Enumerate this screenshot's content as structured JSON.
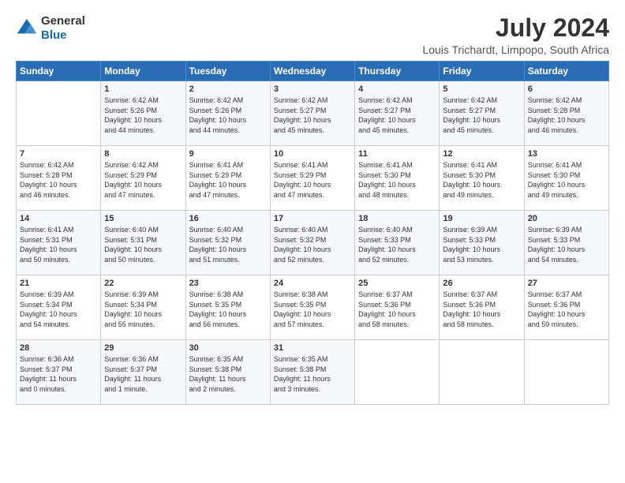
{
  "header": {
    "logo_line1": "General",
    "logo_line2": "Blue",
    "title": "July 2024",
    "subtitle": "Louis Trichardt, Limpopo, South Africa"
  },
  "calendar": {
    "days_of_week": [
      "Sunday",
      "Monday",
      "Tuesday",
      "Wednesday",
      "Thursday",
      "Friday",
      "Saturday"
    ],
    "weeks": [
      [
        {
          "day": "",
          "info": ""
        },
        {
          "day": "1",
          "info": "Sunrise: 6:42 AM\nSunset: 5:26 PM\nDaylight: 10 hours\nand 44 minutes."
        },
        {
          "day": "2",
          "info": "Sunrise: 6:42 AM\nSunset: 5:26 PM\nDaylight: 10 hours\nand 44 minutes."
        },
        {
          "day": "3",
          "info": "Sunrise: 6:42 AM\nSunset: 5:27 PM\nDaylight: 10 hours\nand 45 minutes."
        },
        {
          "day": "4",
          "info": "Sunrise: 6:42 AM\nSunset: 5:27 PM\nDaylight: 10 hours\nand 45 minutes."
        },
        {
          "day": "5",
          "info": "Sunrise: 6:42 AM\nSunset: 5:27 PM\nDaylight: 10 hours\nand 45 minutes."
        },
        {
          "day": "6",
          "info": "Sunrise: 6:42 AM\nSunset: 5:28 PM\nDaylight: 10 hours\nand 46 minutes."
        }
      ],
      [
        {
          "day": "7",
          "info": "Sunrise: 6:42 AM\nSunset: 5:28 PM\nDaylight: 10 hours\nand 46 minutes."
        },
        {
          "day": "8",
          "info": "Sunrise: 6:42 AM\nSunset: 5:29 PM\nDaylight: 10 hours\nand 47 minutes."
        },
        {
          "day": "9",
          "info": "Sunrise: 6:41 AM\nSunset: 5:29 PM\nDaylight: 10 hours\nand 47 minutes."
        },
        {
          "day": "10",
          "info": "Sunrise: 6:41 AM\nSunset: 5:29 PM\nDaylight: 10 hours\nand 47 minutes."
        },
        {
          "day": "11",
          "info": "Sunrise: 6:41 AM\nSunset: 5:30 PM\nDaylight: 10 hours\nand 48 minutes."
        },
        {
          "day": "12",
          "info": "Sunrise: 6:41 AM\nSunset: 5:30 PM\nDaylight: 10 hours\nand 49 minutes."
        },
        {
          "day": "13",
          "info": "Sunrise: 6:41 AM\nSunset: 5:30 PM\nDaylight: 10 hours\nand 49 minutes."
        }
      ],
      [
        {
          "day": "14",
          "info": "Sunrise: 6:41 AM\nSunset: 5:31 PM\nDaylight: 10 hours\nand 50 minutes."
        },
        {
          "day": "15",
          "info": "Sunrise: 6:40 AM\nSunset: 5:31 PM\nDaylight: 10 hours\nand 50 minutes."
        },
        {
          "day": "16",
          "info": "Sunrise: 6:40 AM\nSunset: 5:32 PM\nDaylight: 10 hours\nand 51 minutes."
        },
        {
          "day": "17",
          "info": "Sunrise: 6:40 AM\nSunset: 5:32 PM\nDaylight: 10 hours\nand 52 minutes."
        },
        {
          "day": "18",
          "info": "Sunrise: 6:40 AM\nSunset: 5:33 PM\nDaylight: 10 hours\nand 52 minutes."
        },
        {
          "day": "19",
          "info": "Sunrise: 6:39 AM\nSunset: 5:33 PM\nDaylight: 10 hours\nand 53 minutes."
        },
        {
          "day": "20",
          "info": "Sunrise: 6:39 AM\nSunset: 5:33 PM\nDaylight: 10 hours\nand 54 minutes."
        }
      ],
      [
        {
          "day": "21",
          "info": "Sunrise: 6:39 AM\nSunset: 5:34 PM\nDaylight: 10 hours\nand 54 minutes."
        },
        {
          "day": "22",
          "info": "Sunrise: 6:39 AM\nSunset: 5:34 PM\nDaylight: 10 hours\nand 55 minutes."
        },
        {
          "day": "23",
          "info": "Sunrise: 6:38 AM\nSunset: 5:35 PM\nDaylight: 10 hours\nand 56 minutes."
        },
        {
          "day": "24",
          "info": "Sunrise: 6:38 AM\nSunset: 5:35 PM\nDaylight: 10 hours\nand 57 minutes."
        },
        {
          "day": "25",
          "info": "Sunrise: 6:37 AM\nSunset: 5:36 PM\nDaylight: 10 hours\nand 58 minutes."
        },
        {
          "day": "26",
          "info": "Sunrise: 6:37 AM\nSunset: 5:36 PM\nDaylight: 10 hours\nand 58 minutes."
        },
        {
          "day": "27",
          "info": "Sunrise: 6:37 AM\nSunset: 5:36 PM\nDaylight: 10 hours\nand 59 minutes."
        }
      ],
      [
        {
          "day": "28",
          "info": "Sunrise: 6:36 AM\nSunset: 5:37 PM\nDaylight: 11 hours\nand 0 minutes."
        },
        {
          "day": "29",
          "info": "Sunrise: 6:36 AM\nSunset: 5:37 PM\nDaylight: 11 hours\nand 1 minute."
        },
        {
          "day": "30",
          "info": "Sunrise: 6:35 AM\nSunset: 5:38 PM\nDaylight: 11 hours\nand 2 minutes."
        },
        {
          "day": "31",
          "info": "Sunrise: 6:35 AM\nSunset: 5:38 PM\nDaylight: 11 hours\nand 3 minutes."
        },
        {
          "day": "",
          "info": ""
        },
        {
          "day": "",
          "info": ""
        },
        {
          "day": "",
          "info": ""
        }
      ]
    ]
  }
}
